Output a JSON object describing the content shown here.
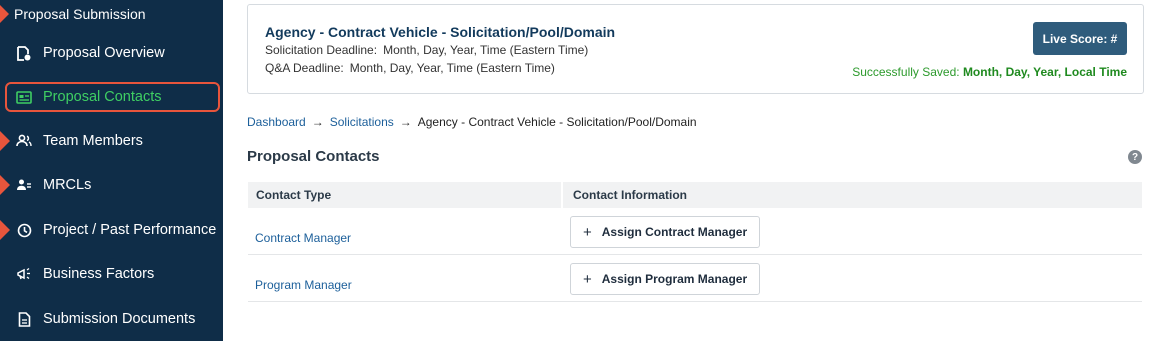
{
  "sidebar": {
    "section_title": "Proposal Submission",
    "items": [
      {
        "label": "Proposal Overview",
        "icon": "document-icon"
      },
      {
        "label": "Proposal Contacts",
        "icon": "contact-card-icon",
        "active": true
      },
      {
        "label": "Team Members",
        "icon": "team-icon"
      },
      {
        "label": "MRCLs",
        "icon": "users-icon"
      },
      {
        "label": "Project / Past Performance",
        "icon": "clock-icon"
      },
      {
        "label": "Business Factors",
        "icon": "megaphone-icon"
      },
      {
        "label": "Submission Documents",
        "icon": "file-icon"
      }
    ]
  },
  "header": {
    "title": "Agency - Contract Vehicle - Solicitation/Pool/Domain",
    "solicitation_label": "Solicitation Deadline:",
    "solicitation_value": "Month, Day, Year, Time (Eastern Time)",
    "qa_label": "Q&A Deadline:",
    "qa_value": "Month, Day, Year, Time (Eastern Time)",
    "live_score": "Live Score: #",
    "saved_prefix": "Successfully Saved:",
    "saved_value": "Month, Day, Year, Local Time"
  },
  "breadcrumb": {
    "items": [
      "Dashboard",
      "Solicitations",
      "Agency - Contract Vehicle - Solicitation/Pool/Domain"
    ],
    "separator": "→"
  },
  "page": {
    "title": "Proposal Contacts",
    "help": "?"
  },
  "table": {
    "headers": [
      "Contact Type",
      "Contact Information"
    ],
    "rows": [
      {
        "type": "Contract Manager",
        "action": "Assign Contract Manager"
      },
      {
        "type": "Program Manager",
        "action": "Assign Program Manager"
      }
    ],
    "plus": "+"
  },
  "colors": {
    "sidebar_bg": "#0f2d48",
    "accent": "#e8553c",
    "active_text": "#3fce63",
    "button_bg": "#2f5c7c",
    "link": "#1c5f9a",
    "success": "#2c9a2c"
  }
}
